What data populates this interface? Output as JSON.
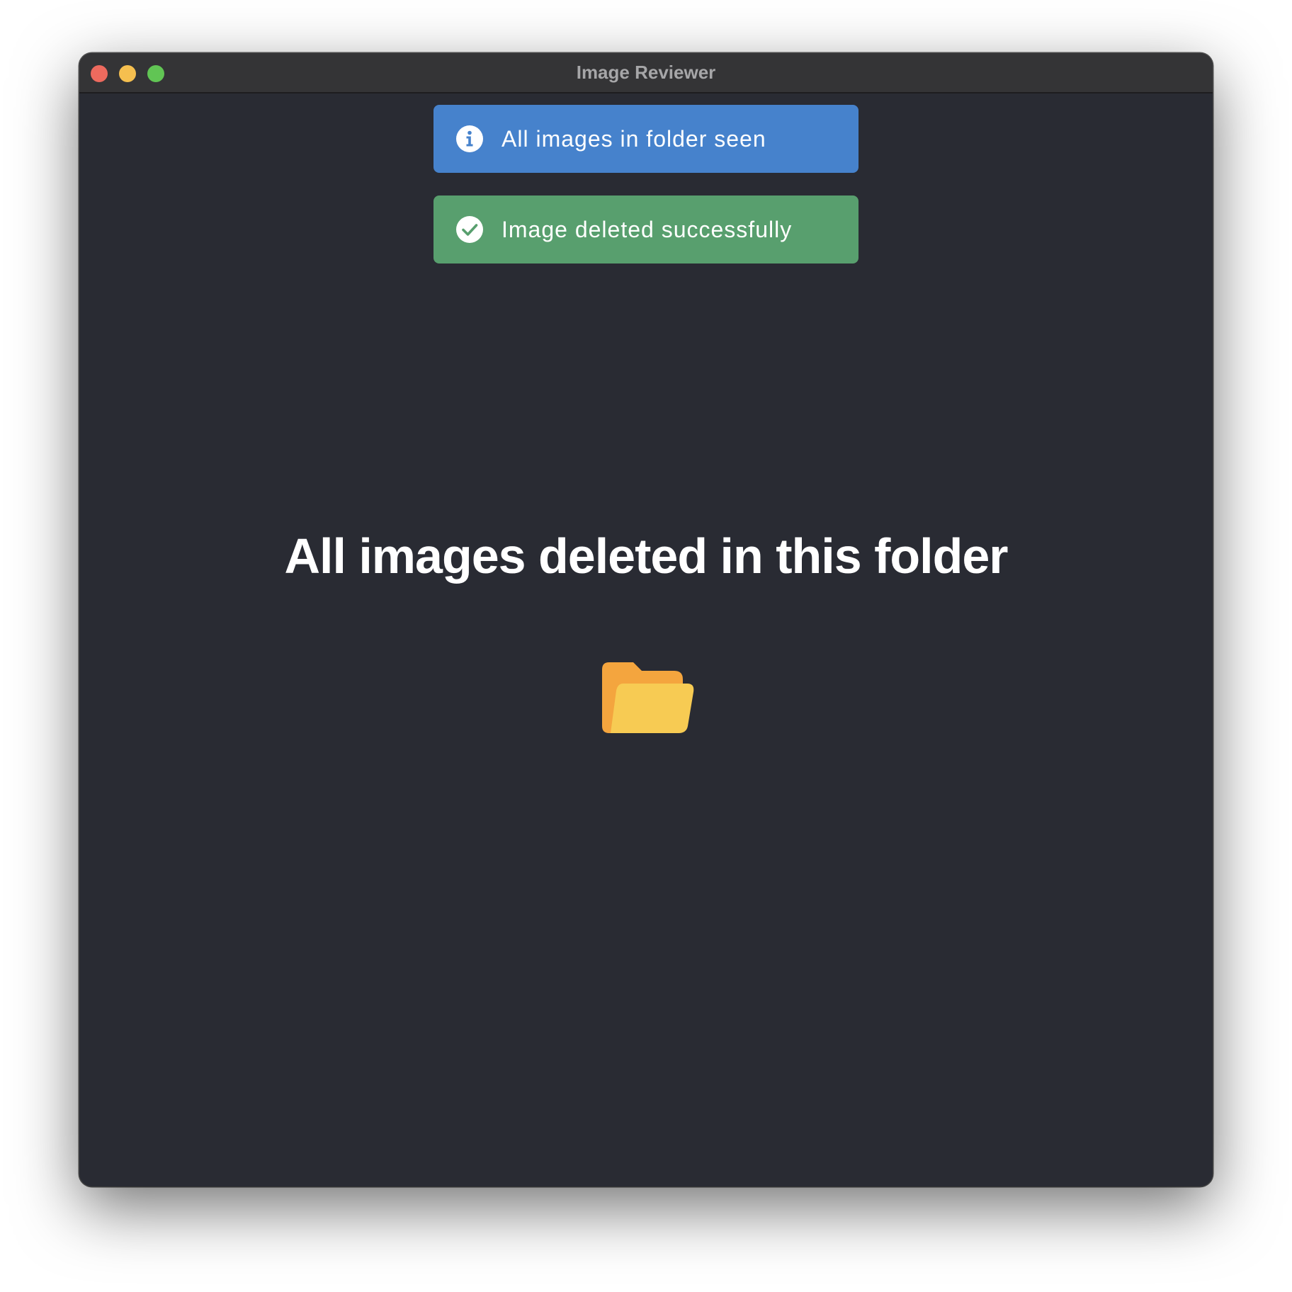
{
  "window": {
    "title": "Image Reviewer"
  },
  "toasts": [
    {
      "type": "info",
      "icon": "info-icon",
      "message": "All images in folder seen",
      "color": "#4682cc"
    },
    {
      "type": "success",
      "icon": "check-circle-icon",
      "message": "Image deleted successfully",
      "color": "#589f6e"
    }
  ],
  "main": {
    "message": "All images deleted in this folder",
    "icon": "open-folder-icon"
  },
  "colors": {
    "background": "#292b33",
    "titlebar": "#343436",
    "folder_back": "#f4a53e",
    "folder_front": "#f7cb53"
  }
}
